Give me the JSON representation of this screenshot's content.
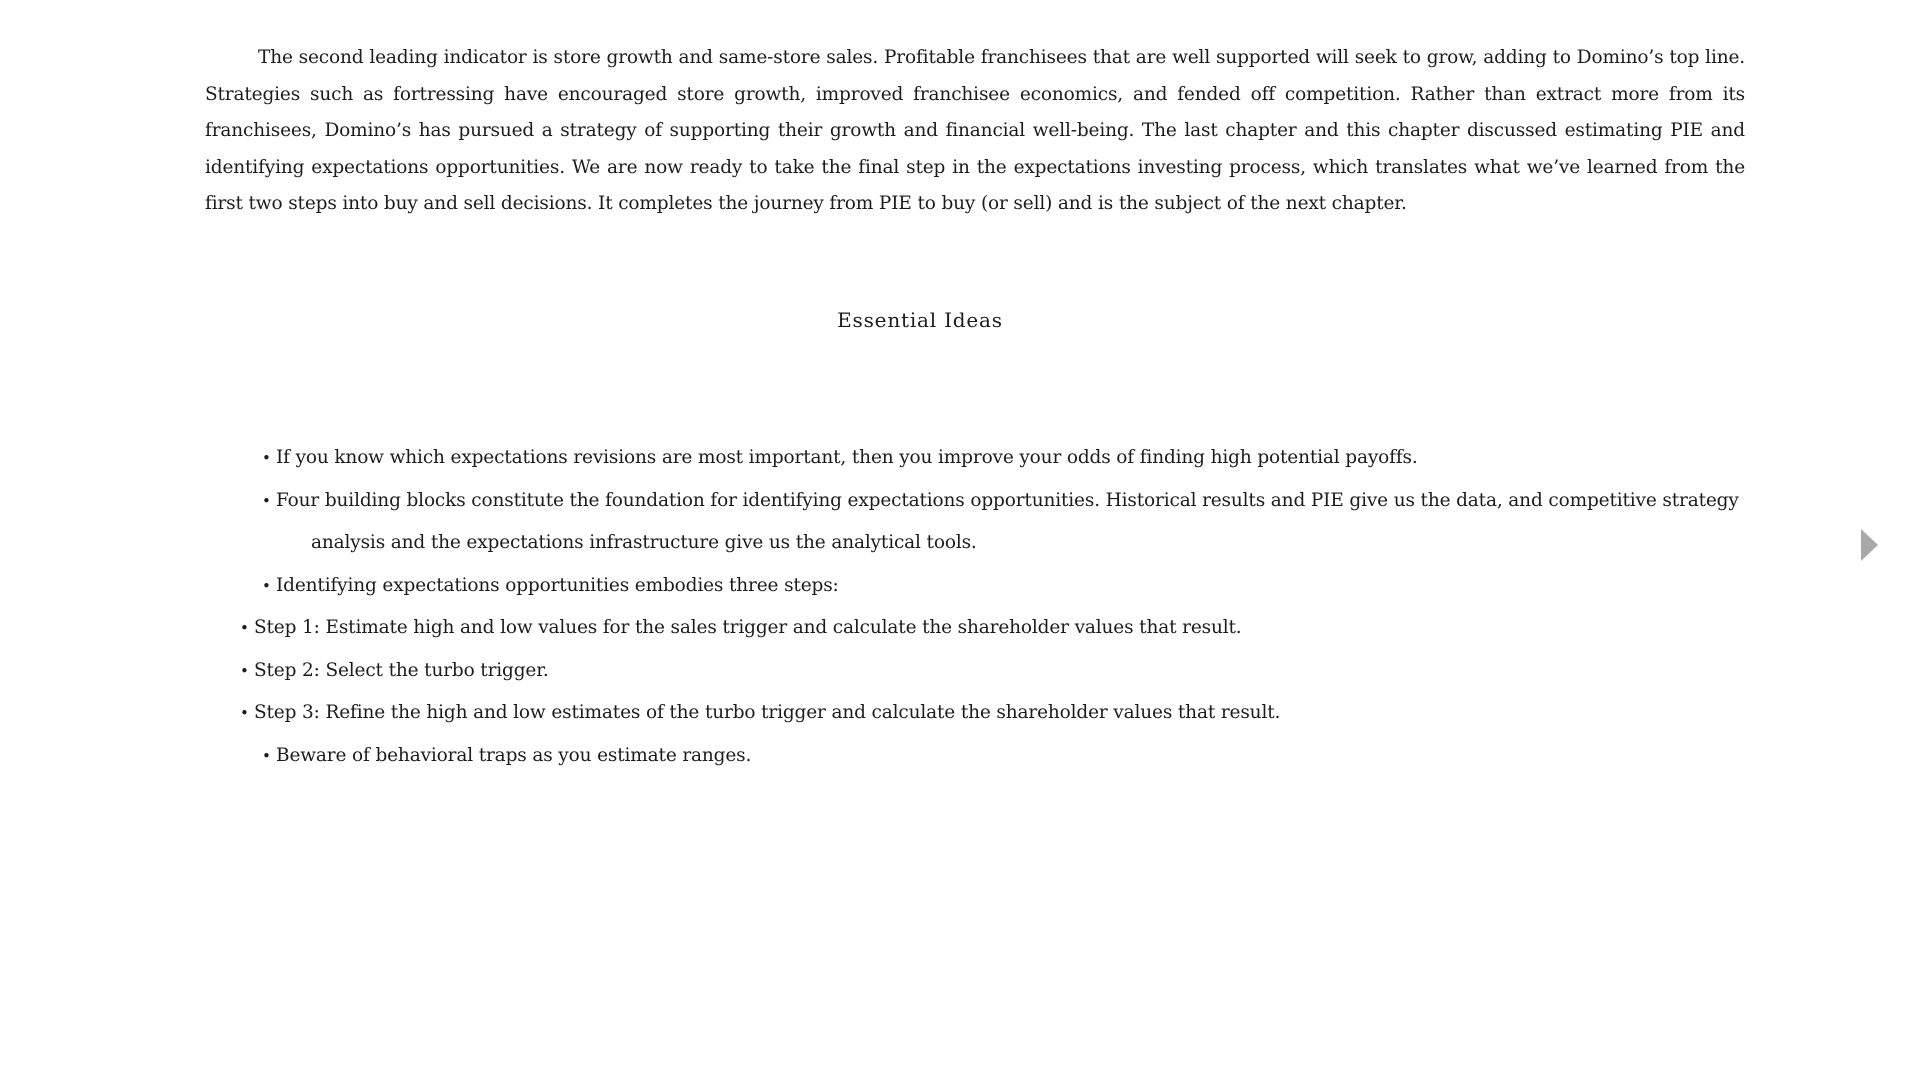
{
  "content": {
    "intro_paragraph": "The second leading indicator is store growth and same-store sales. Profitable franchisees that are well supported will seek to grow, adding to Domino’s top line. Strategies such as fortressing have encouraged store growth, improved franchisee economics, and fended off competition. Rather than extract more from its franchisees, Domino’s has pursued a strategy of supporting their growth and financial well-being. The last chapter and this chapter discussed estimating PIE and identifying expectations opportunities. We are now ready to take the final step in the expectations investing process, which translates what we’ve learned from the first two steps into buy and sell decisions. It completes the journey from PIE to buy (or sell) and is the subject of the next chapter.",
    "section_heading": "Essential Ideas",
    "ideas": [
      {
        "text": "If you know which expectations revisions are most important, then you improve your odds of finding high potential payoffs."
      },
      {
        "text": "Four building blocks constitute the foundation for identifying expectations opportunities. Historical results and PIE give us the data, and competitive strategy",
        "continuation": "analysis and the expectations infrastructure give us the analytical tools."
      },
      {
        "text": "Identifying expectations opportunities embodies three steps:"
      },
      {
        "text": "Step 1: Estimate high and low values for the sales trigger and calculate the shareholder values that result."
      },
      {
        "text": "Step 2: Select the turbo trigger."
      },
      {
        "text": "Step 3: Refine the high and low estimates of the turbo trigger and calculate the shareholder values that result."
      },
      {
        "text": "Beware of behavioral traps as you estimate ranges."
      }
    ],
    "bullet_glyph": "•"
  },
  "navigation": {
    "next_page_icon": "triangle-right-icon",
    "icon_color": "#a8a8a8"
  }
}
